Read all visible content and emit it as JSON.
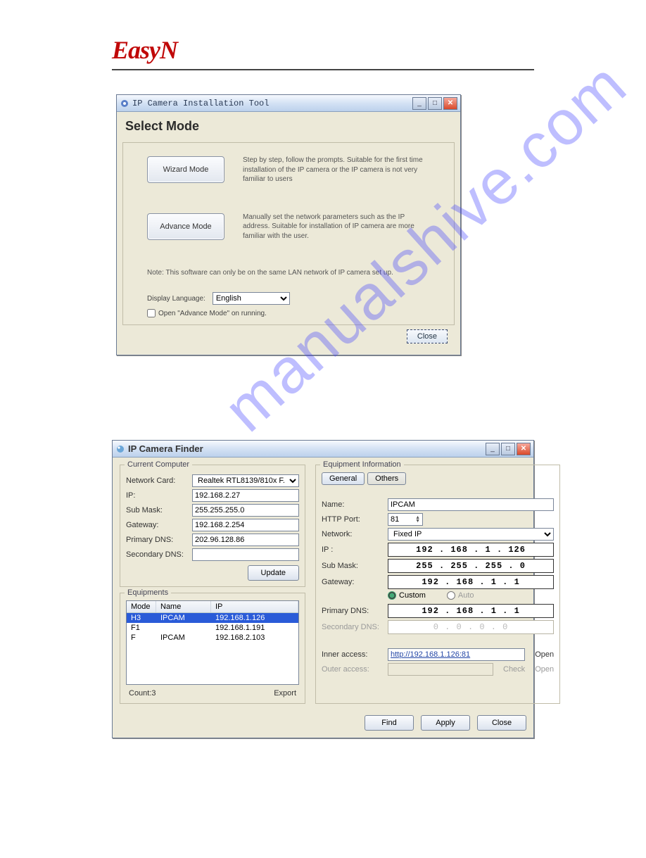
{
  "logo": "EasyN",
  "watermark": "manualshive.com",
  "win1": {
    "title": "IP Camera Installation Tool",
    "heading": "Select Mode",
    "wizard_btn": "Wizard Mode",
    "wizard_desc": "Step by step, follow the prompts. Suitable for the first time installation of the IP camera or the IP camera is not very familiar to users",
    "advance_btn": "Advance Mode",
    "advance_desc": "Manually set the network parameters such as the IP address. Suitable for installation of IP camera are more familiar with the user.",
    "note": "Note: This software can only be on the same LAN network of IP camera set up.",
    "lang_label": "Display Language:",
    "lang_value": "English",
    "cb_label": "Open \"Advance Mode\" on running.",
    "close_btn": "Close"
  },
  "win2": {
    "title": "IP Camera Finder",
    "left_group": "Current Computer",
    "nic_label": "Network Card:",
    "nic_value": "Realtek RTL8139/810x F.",
    "ip_label": "IP:",
    "ip_value": "192.168.2.27",
    "mask_label": "Sub Mask:",
    "mask_value": "255.255.255.0",
    "gw_label": "Gateway:",
    "gw_value": "192.168.2.254",
    "pdns_label": "Primary DNS:",
    "pdns_value": "202.96.128.86",
    "sdns_label": "Secondary DNS:",
    "update_btn": "Update",
    "equip_group": "Equipments",
    "cols": {
      "mode": "Mode",
      "name": "Name",
      "ip": "IP"
    },
    "rows": [
      {
        "mode": "H3",
        "name": "IPCAM",
        "ip": "192.168.1.126"
      },
      {
        "mode": "F1",
        "name": "",
        "ip": "192.168.1.191"
      },
      {
        "mode": "F",
        "name": "IPCAM",
        "ip": "192.168.2.103"
      }
    ],
    "count_label": "Count:3",
    "export_label": "Export",
    "right_group": "Equipment Information",
    "tab_general": "General",
    "tab_others": "Others",
    "name_label": "Name:",
    "name_value": "IPCAM",
    "port_label": "HTTP Port:",
    "port_value": "81",
    "net_label": "Network:",
    "net_value": "Fixed IP",
    "rip_label": "IP  :",
    "rip_value": "192 . 168 .  1  . 126",
    "rmask_label": "Sub Mask:",
    "rmask_value": "255 . 255 . 255 .  0",
    "rgw_label": "Gateway:",
    "rgw_value": "192 . 168 .  1  .  1",
    "radio_custom": "Custom",
    "radio_auto": "Auto",
    "rpdns_label": "Primary DNS:",
    "rpdns_value": "192 . 168 .  1  .  1",
    "rsdns_label": "Secondary DNS:",
    "rsdns_value": "0  .  0  .  0  .  0",
    "inner_label": "Inner access:",
    "inner_value": "http://192.168.1.126:81",
    "open": "Open",
    "outer_label": "Outer access:",
    "check": "Check",
    "find_btn": "Find",
    "apply_btn": "Apply",
    "close_btn": "Close"
  }
}
